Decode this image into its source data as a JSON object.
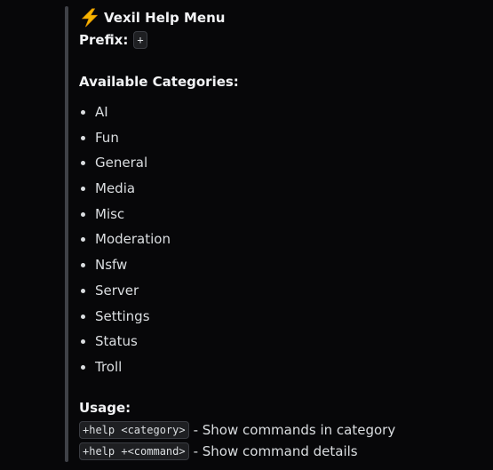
{
  "embed": {
    "title_icon": "lightning-bolt-icon",
    "title": "Vexil Help Menu",
    "prefix_label": "Prefix:",
    "prefix_value": "+",
    "categories_heading": "Available Categories:",
    "categories": [
      "AI",
      "Fun",
      "General",
      "Media",
      "Misc",
      "Moderation",
      "Nsfw",
      "Server",
      "Settings",
      "Status",
      "Troll"
    ],
    "usage_heading": "Usage:",
    "usage": [
      {
        "code": "+help <category>",
        "description": "- Show commands in category"
      },
      {
        "code": "+help +<command>",
        "description": "- Show command details"
      }
    ]
  },
  "colors": {
    "background": "#070709",
    "embed_border": "#3f4147",
    "text": "#dbdee1",
    "bolt": "#f5b400"
  }
}
